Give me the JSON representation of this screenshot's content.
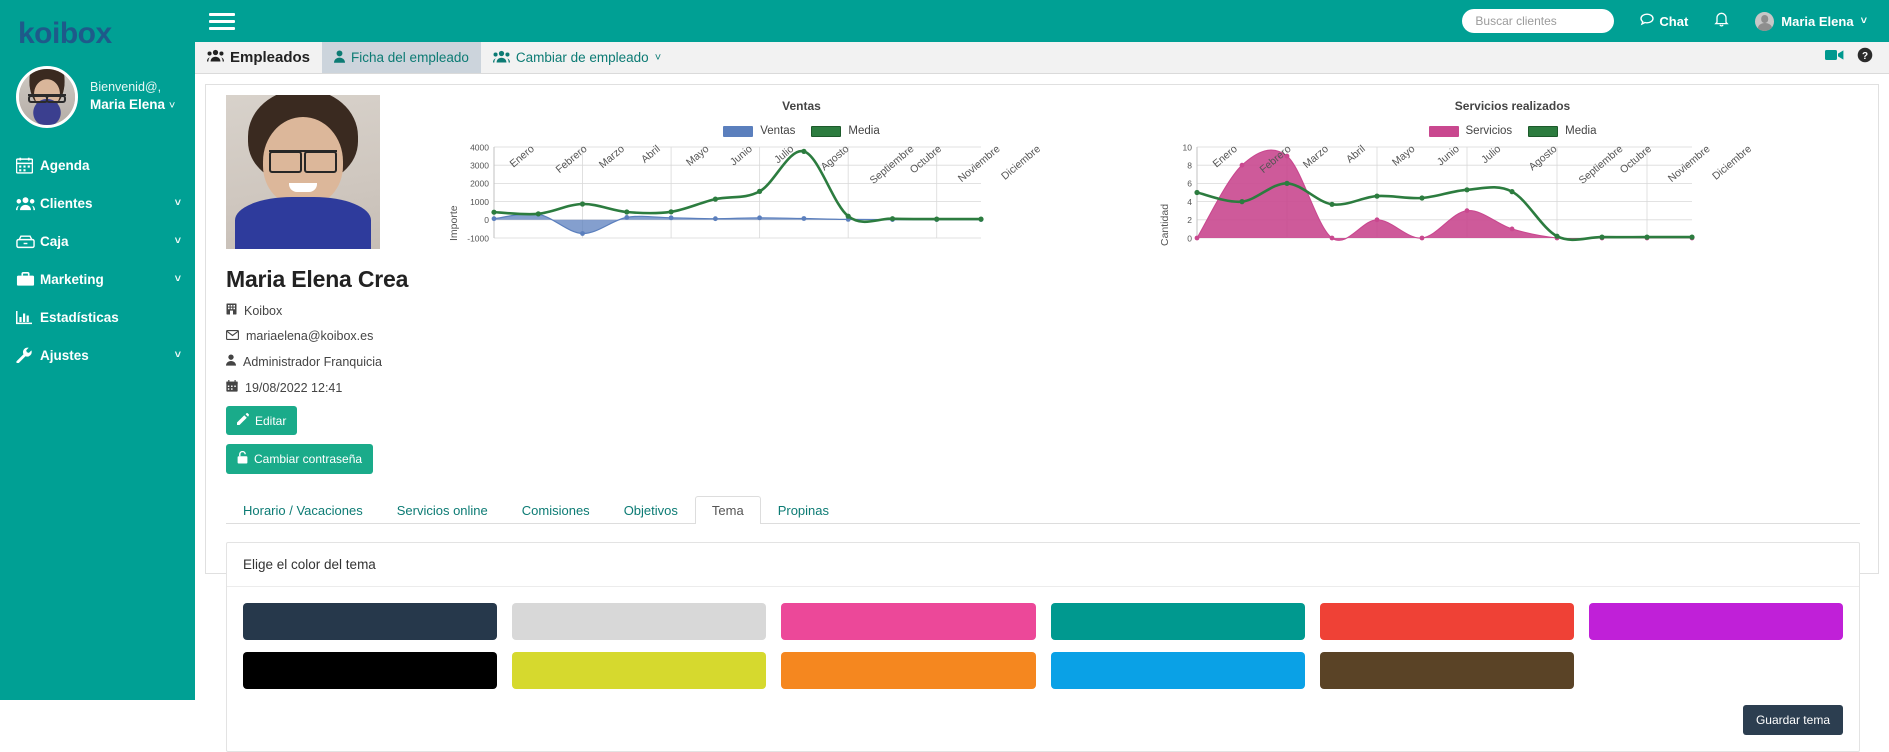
{
  "brand": {
    "name": "koibox"
  },
  "sidebar": {
    "welcome_line1": "Bienvenid@,",
    "welcome_name": "Maria Elena",
    "caret": "˅",
    "items": [
      {
        "label": "Agenda",
        "icon": "calendar-icon",
        "caret": ""
      },
      {
        "label": "Clientes",
        "icon": "users-icon",
        "caret": "˅"
      },
      {
        "label": "Caja",
        "icon": "cash-drawer-icon",
        "caret": "˅"
      },
      {
        "label": "Marketing",
        "icon": "briefcase-icon",
        "caret": "˅"
      },
      {
        "label": "Estadísticas",
        "icon": "bar-chart-icon",
        "caret": ""
      },
      {
        "label": "Ajustes",
        "icon": "wrench-icon",
        "caret": "˅"
      }
    ]
  },
  "topbar": {
    "menu_icon": "hamburger-icon",
    "search_placeholder": "Buscar clientes",
    "search_value": "",
    "chat_label": "Chat",
    "chat_icon": "chat-bubble-icon",
    "notifications_icon": "bell-icon",
    "user_name": "Maria Elena",
    "user_caret": "˅"
  },
  "modbar": {
    "tabs": [
      {
        "label": "Empleados",
        "icon": "users-icon",
        "state": "main"
      },
      {
        "label": "Ficha del empleado",
        "icon": "user-icon",
        "state": "active"
      },
      {
        "label": "Cambiar de empleado",
        "icon": "users-icon",
        "state": "plain",
        "caret": "˅"
      }
    ],
    "video_icon": "video-camera-icon",
    "help_icon": "help-circle-icon"
  },
  "profile": {
    "photo_alt": "employee-photo",
    "name": "Maria Elena Crea",
    "company": "Koibox",
    "email": "mariaelena@koibox.es",
    "role": "Administrador Franquicia",
    "last_login": "19/08/2022 12:41",
    "edit_button": "Editar",
    "password_button": "Cambiar contraseña"
  },
  "chart_data": [
    {
      "type": "line",
      "title": "Ventas",
      "xlabel": "",
      "ylabel": "Importe",
      "ylim": [
        -1000,
        4000
      ],
      "yticks": [
        -1000,
        0,
        1000,
        2000,
        3000,
        4000
      ],
      "grid": true,
      "legend_position": "top",
      "categories": [
        "Enero",
        "Febrero",
        "Marzo",
        "Abril",
        "Mayo",
        "Junio",
        "Julio",
        "Agosto",
        "Septiembre",
        "Octubre",
        "Noviembre",
        "Diciembre"
      ],
      "series": [
        {
          "name": "Ventas",
          "color": "#5b7fbd",
          "values": [
            60,
            300,
            -750,
            130,
            110,
            60,
            110,
            70,
            20,
            10,
            10,
            10
          ]
        },
        {
          "name": "Media",
          "color": "#2c7c3f",
          "values": [
            420,
            330,
            870,
            430,
            440,
            1140,
            1560,
            3760,
            200,
            60,
            40,
            40
          ]
        }
      ]
    },
    {
      "type": "line",
      "title": "Servicios realizados",
      "xlabel": "",
      "ylabel": "Cantidad",
      "ylim": [
        0,
        10
      ],
      "yticks": [
        0,
        2,
        4,
        6,
        8,
        10
      ],
      "grid": true,
      "legend_position": "top",
      "categories": [
        "Enero",
        "Febrero",
        "Marzo",
        "Abril",
        "Mayo",
        "Junio",
        "Julio",
        "Agosto",
        "Septiembre",
        "Octubre",
        "Noviembre",
        "Diciembre"
      ],
      "series": [
        {
          "name": "Servicios",
          "color": "#c9488f",
          "values": [
            0,
            8,
            9,
            0,
            2,
            0,
            3,
            1,
            0,
            0,
            0,
            0
          ]
        },
        {
          "name": "Media",
          "color": "#2c7c3f",
          "values": [
            5,
            4,
            6,
            3.7,
            4.6,
            4.4,
            5.3,
            5.1,
            0.2,
            0.1,
            0.1,
            0.1
          ]
        }
      ]
    }
  ],
  "tabs": [
    {
      "label": "Horario / Vacaciones",
      "active": false
    },
    {
      "label": "Servicios online",
      "active": false
    },
    {
      "label": "Comisiones",
      "active": false
    },
    {
      "label": "Objetivos",
      "active": false
    },
    {
      "label": "Tema",
      "active": true
    },
    {
      "label": "Propinas",
      "active": false
    }
  ],
  "theme": {
    "heading": "Elige el color del tema",
    "save_label": "Guardar tema",
    "swatches": [
      "#26384b",
      "#d8d8d8",
      "#ec4899",
      "#00998f",
      "#ef4136",
      "#c020d8",
      "#000000",
      "#d6d92e",
      "#f5871f",
      "#0aa1e6",
      "#5a4326",
      "#ffffff"
    ]
  }
}
